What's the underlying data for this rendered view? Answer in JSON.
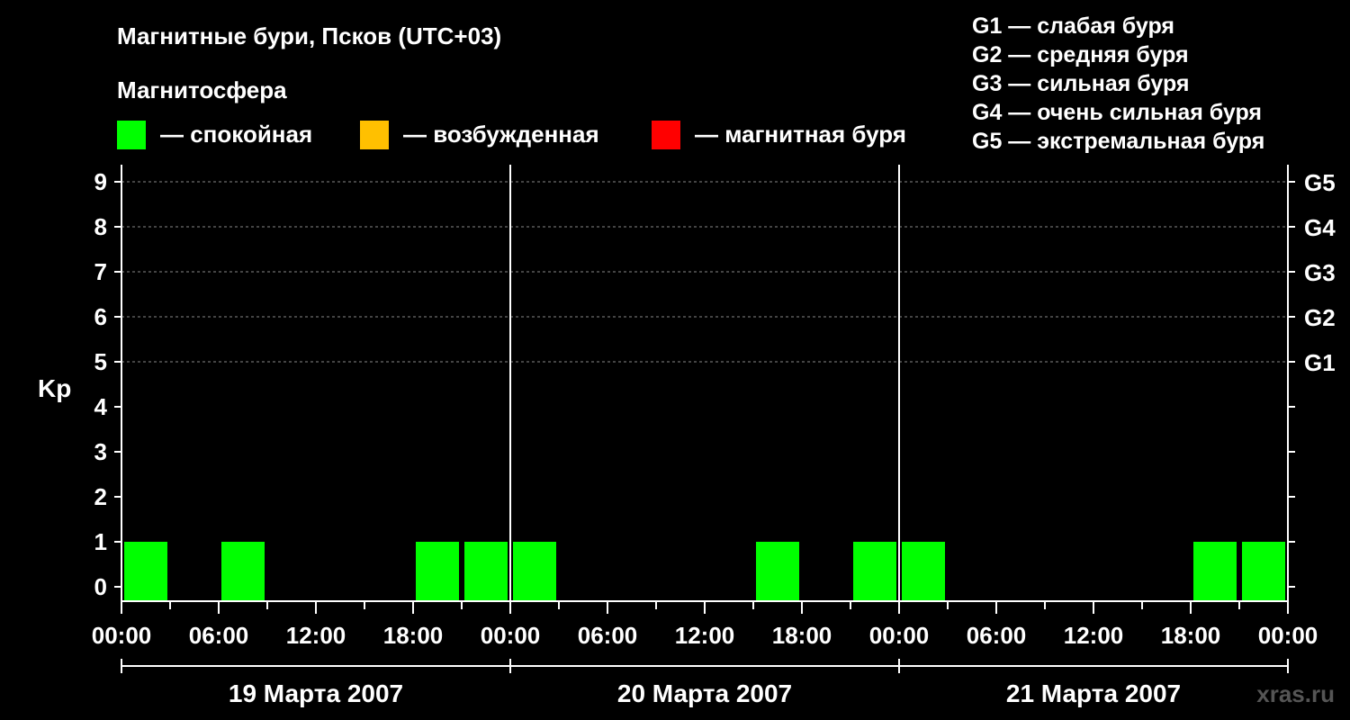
{
  "title": "Магнитные бури, Псков (UTC+03)",
  "legend": {
    "heading": "Магнитосфера",
    "items": [
      {
        "color": "#00ff00",
        "label": "— спокойная"
      },
      {
        "color": "#ffc000",
        "label": "— возбужденная"
      },
      {
        "color": "#ff0000",
        "label": "— магнитная буря"
      }
    ]
  },
  "storm_scale": [
    "G1 — слабая буря",
    "G2 — средняя буря",
    "G3 — сильная буря",
    "G4 — очень сильная буря",
    "G5 — экстремальная буря"
  ],
  "watermark": "xras.ru",
  "chart_data": {
    "type": "bar",
    "title": "Магнитные бури, Псков (UTC+03)",
    "ylabel": "Kp",
    "ylim": [
      0,
      9
    ],
    "yticks": [
      "0",
      "1",
      "2",
      "3",
      "4",
      "5",
      "6",
      "7",
      "8",
      "9"
    ],
    "right_labels": [
      {
        "value": 5,
        "label": "G1"
      },
      {
        "value": 6,
        "label": "G2"
      },
      {
        "value": 7,
        "label": "G3"
      },
      {
        "value": 8,
        "label": "G4"
      },
      {
        "value": 9,
        "label": "G5"
      }
    ],
    "grid": "dashed horizontal at Kp 5-9",
    "xtick_labels": [
      "00:00",
      "06:00",
      "12:00",
      "18:00",
      "00:00",
      "06:00",
      "12:00",
      "18:00",
      "00:00",
      "06:00",
      "12:00",
      "18:00",
      "00:00"
    ],
    "days": [
      "19 Марта 2007",
      "20 Марта 2007",
      "21 Марта 2007"
    ],
    "interval_hours": 3,
    "values": [
      [
        1,
        0,
        1,
        0,
        0,
        0,
        1,
        1
      ],
      [
        1,
        0,
        0,
        0,
        0,
        1,
        0,
        1
      ],
      [
        1,
        0,
        0,
        0,
        0,
        0,
        1,
        1
      ]
    ],
    "colors": {
      "quiet": "#00ff00",
      "active": "#ffc000",
      "storm": "#ff0000"
    }
  }
}
